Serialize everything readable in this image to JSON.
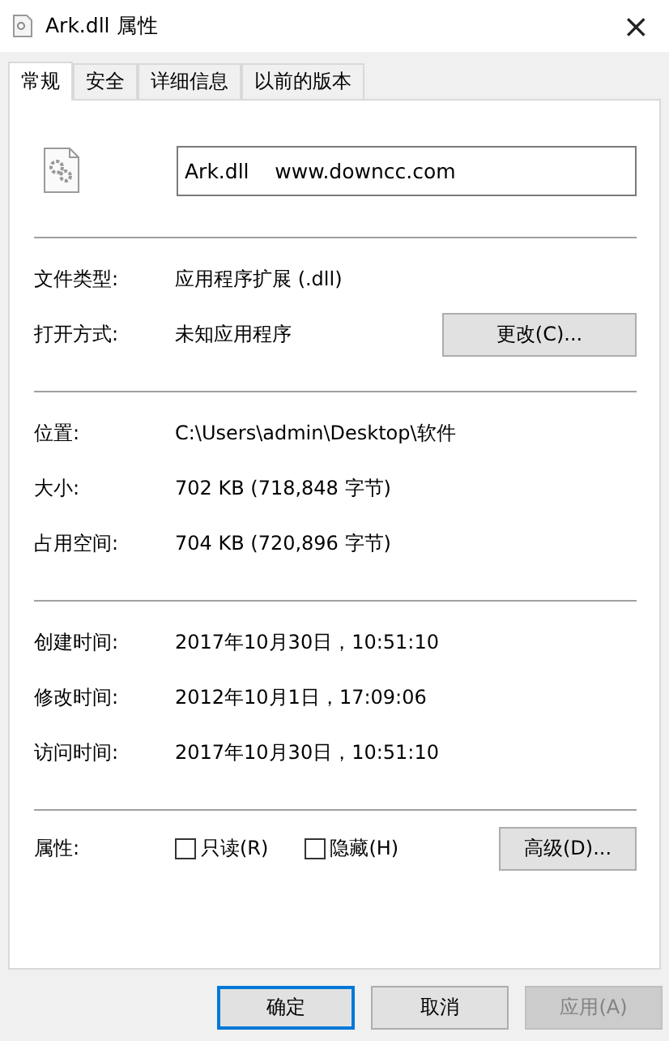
{
  "window": {
    "title": "Ark.dll 属性",
    "close": "×"
  },
  "tabs": [
    {
      "label": "常规",
      "selected": true
    },
    {
      "label": "安全",
      "selected": false
    },
    {
      "label": "详细信息",
      "selected": false
    },
    {
      "label": "以前的版本",
      "selected": false
    }
  ],
  "file_name": "Ark.dll    www.downcc.com",
  "sections": [
    [
      {
        "kind": "text",
        "label": "文件类型:",
        "value": "应用程序扩展 (.dll)"
      },
      {
        "kind": "button",
        "label": "打开方式:",
        "value": "未知应用程序",
        "button": "更改(C)..."
      }
    ],
    [
      {
        "kind": "text",
        "label": "位置:",
        "value": "C:\\Users\\admin\\Desktop\\软件"
      },
      {
        "kind": "text",
        "label": "大小:",
        "value": "702 KB (718,848 字节)"
      },
      {
        "kind": "text",
        "label": "占用空间:",
        "value": "704 KB (720,896 字节)"
      }
    ],
    [
      {
        "kind": "text",
        "label": "创建时间:",
        "value": "2017年10月30日，10:51:10"
      },
      {
        "kind": "text",
        "label": "修改时间:",
        "value": "2012年10月1日，17:09:06"
      },
      {
        "kind": "text",
        "label": "访问时间:",
        "value": "2017年10月30日，10:51:10"
      }
    ]
  ],
  "attributes": {
    "label": "属性:",
    "checkboxes": [
      {
        "label": "只读(R)",
        "checked": false
      },
      {
        "label": "隐藏(H)",
        "checked": false
      }
    ],
    "button": "高级(D)..."
  },
  "buttons": [
    {
      "label": "确定",
      "default": true,
      "disabled": false
    },
    {
      "label": "取消",
      "default": false,
      "disabled": false
    },
    {
      "label": "应用(A)",
      "default": false,
      "disabled": true
    }
  ]
}
